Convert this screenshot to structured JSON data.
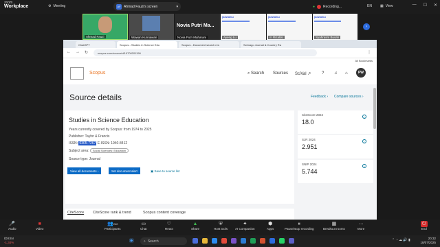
{
  "zoom_top": {
    "app_line1": "zoom",
    "app_line2": "Workplace",
    "meeting_label": "Meeting",
    "share_initials": "AF",
    "share_label": "Ahmad Fauzi's screen",
    "recording_label": "Recording...",
    "lang": "EN",
    "view_label": "View"
  },
  "strip": {
    "tiles": [
      {
        "name": "Ahmad Fauzi"
      },
      {
        "name": "Wawan Kurniawan"
      },
      {
        "name": "Novia Putri Maharani",
        "big_label": "Novia Putri Ma..."
      },
      {
        "name": "Ayeng Lu"
      },
      {
        "name": "m Rizaldo"
      },
      {
        "name": "Syahrasm Busah"
      }
    ],
    "slide_brand": "jadwalku",
    "next_icon": "›"
  },
  "browser": {
    "tabs": [
      {
        "label": "ChatGPT"
      },
      {
        "label": "Scopus - Studies in Science Edu"
      },
      {
        "label": "Scopus - Document search res"
      },
      {
        "label": "Scimago Journal & Country Ra"
      }
    ],
    "url": "scopus.com/sourceid/19700201156",
    "all_bookmarks": "All Bookmarks"
  },
  "scopus": {
    "brand": "Scopus",
    "nav": {
      "search": "Search",
      "sources": "Sources",
      "scival": "SciVal ↗"
    },
    "avatar": "PW",
    "page_title": "Source details",
    "feedback": "Feedback ›",
    "compare": "Compare sources ›",
    "journal_title": "Studies in Science Education",
    "coverage": "Years currently covered by Scopus:  from 1974 to 2025",
    "publisher": "Publisher:  Taylor & Francis",
    "issn_label": "ISSN:",
    "issn_value": "0305-7267",
    "eissn": "E-ISSN:    1940-8412",
    "subject_label": "Subject area:",
    "subject_value": "Social Sciences: Education",
    "source_type": "Source type:  Journal",
    "btn_docs": "View all documents ›",
    "btn_alert": "Set document alert",
    "save_list": "Save to source list",
    "metrics": [
      {
        "label": "CiteScore 2024",
        "value": "18.0"
      },
      {
        "label": "SJR 2024",
        "value": "2.951"
      },
      {
        "label": "SNIP 2024",
        "value": "5.744"
      }
    ],
    "subtabs": [
      "CiteScore",
      "CiteScore rank & trend",
      "Scopus content coverage"
    ]
  },
  "zoom_bottom": {
    "audio": "Audio",
    "video": "Video",
    "participants": "Participants",
    "participants_count": "240",
    "chat": "Chat",
    "react": "React",
    "share": "Share",
    "host_tools": "Host tools",
    "ai_companion": "AI Companion",
    "apps": "Apps",
    "pause_recording": "Pause/stop recording",
    "breakout": "Breakout rooms",
    "more": "More",
    "end": "End"
  },
  "taskbar": {
    "ticker_name": "IDXSN",
    "ticker_value": "-1,34%",
    "search": "Search",
    "time": "20:32",
    "date": "18/07/2025"
  },
  "colors": {
    "scopus_orange": "#e9711c",
    "zoom_blue": "#2d6cdf",
    "record_red": "#e03636"
  }
}
